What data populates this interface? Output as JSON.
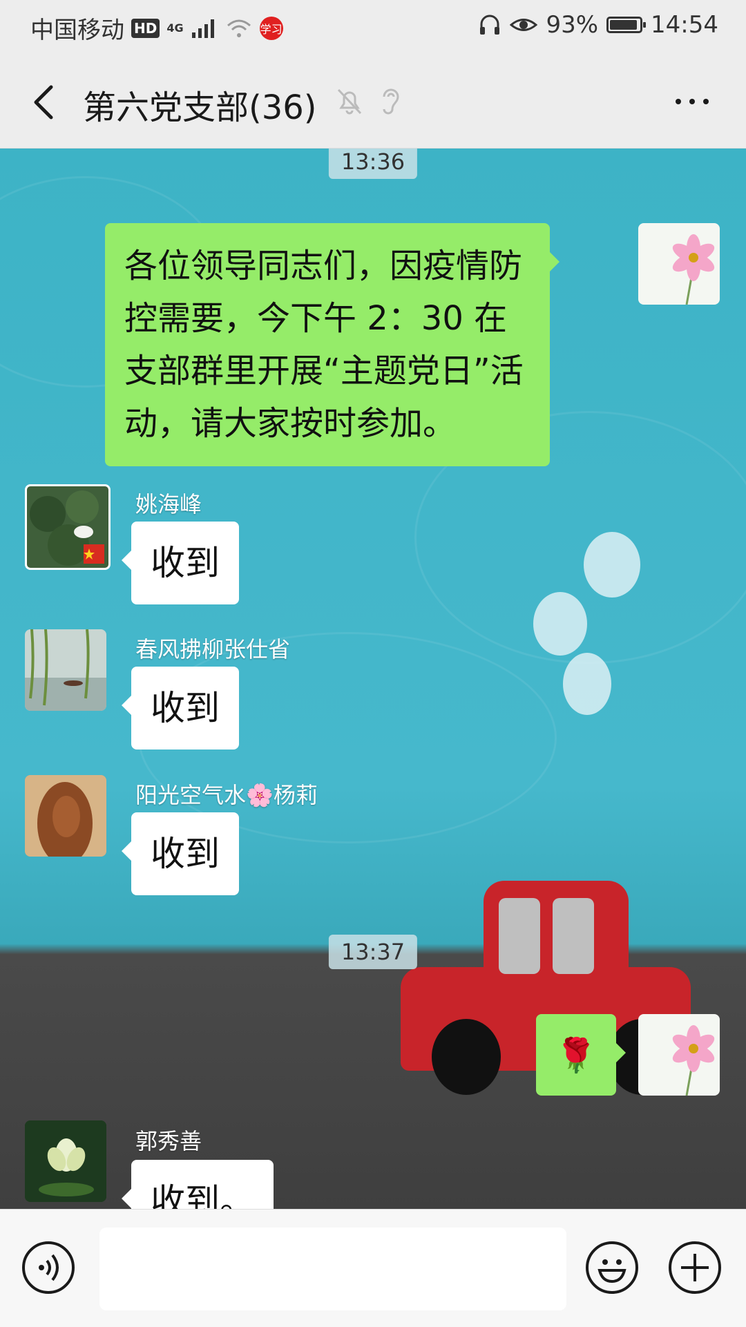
{
  "status_bar": {
    "carrier": "中国移动",
    "hd": "HD",
    "network": "4G",
    "app_badge": "学习",
    "battery_pct": "93%",
    "battery_level": 0.93,
    "time": "14:54"
  },
  "header": {
    "title": "第六党支部(36)"
  },
  "messages": {
    "time1": "13:36",
    "m1_text": "各位领导同志们，因疫情防控需要，今下午 2：30 在支部群里开展“主题党日”活动，请大家按时参加。",
    "m2_name": "姚海峰",
    "m2_text": "收到",
    "m3_name": "春风拂柳张仕省",
    "m3_text": "收到",
    "m4_name": "阳光空气水🌸杨莉",
    "m4_text": "收到",
    "time2": "13:37",
    "m5_text": "🌹",
    "m6_name": "郭秀善",
    "m6_text": "收到。"
  },
  "colors": {
    "outgoing_bubble": "#95ec69",
    "incoming_bubble": "#ffffff",
    "chat_bg": "#3db3c6"
  }
}
